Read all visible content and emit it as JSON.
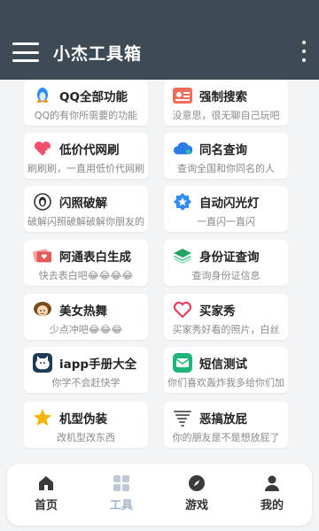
{
  "app": {
    "title": "小杰工具箱"
  },
  "tools": [
    {
      "name": "QQ全部功能",
      "desc": "QQ的有你所需要的功能",
      "icon": "penguin-icon"
    },
    {
      "name": "强制搜索",
      "desc": "没意思，很无聊自己玩吧",
      "icon": "id-card-icon"
    },
    {
      "name": "低价代网刷",
      "desc": "刷刷刷，一直用低价代网刷",
      "icon": "heart-plus-icon"
    },
    {
      "name": "同名查询",
      "desc": "查询全国和你同名的人",
      "icon": "cloud-icon"
    },
    {
      "name": "闪照破解",
      "desc": "破解闪照破解破解你朋友的",
      "icon": "penguin-circle-icon"
    },
    {
      "name": "自动闪光灯",
      "desc": "一直闪一直闪",
      "icon": "star-badge-icon"
    },
    {
      "name": "阿通表白生成",
      "desc": "快去表白吧😂😂😂😂",
      "icon": "love-letter-icon"
    },
    {
      "name": "身份证查询",
      "desc": "查询身份证信息",
      "icon": "layers-icon"
    },
    {
      "name": "美女热舞",
      "desc": "少点冲吧😂😂😂",
      "icon": "girl-icon"
    },
    {
      "name": "买家秀",
      "desc": "买家秀好看的照片，白丝",
      "icon": "heart-outline-icon"
    },
    {
      "name": "iapp手册大全",
      "desc": "你学不会赶快学",
      "icon": "cat-icon"
    },
    {
      "name": "短信测试",
      "desc": "你们喜欢轰炸我多给你们加",
      "icon": "message-icon"
    },
    {
      "name": "机型伪装",
      "desc": "改机型改东西",
      "icon": "star-icon"
    },
    {
      "name": "恶搞放屁",
      "desc": "你的朋友是不是想放屁了",
      "icon": "tornado-icon"
    }
  ],
  "tabs": [
    {
      "label": "首页",
      "icon": "home-icon"
    },
    {
      "label": "工具",
      "icon": "grid-icon",
      "active": true
    },
    {
      "label": "游戏",
      "icon": "compass-icon"
    },
    {
      "label": "我的",
      "icon": "user-icon"
    }
  ],
  "colors": {
    "appbar": "#3e4b55",
    "active_tab": "#9fb3c8",
    "background": "#f3f4f6"
  }
}
